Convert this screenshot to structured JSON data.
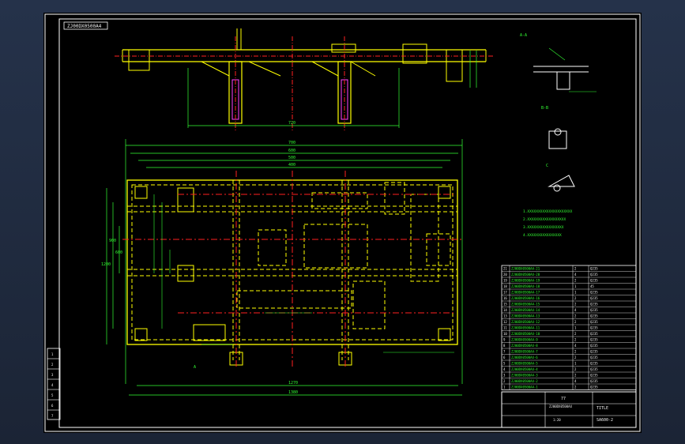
{
  "drawing": {
    "title_tag": "ZJ00DX0500A4",
    "frame_color": "#ffffff",
    "colors": {
      "yellow": "#ffff00",
      "red": "#ff2020",
      "green": "#33ff33",
      "cyan": "#00e5ff",
      "magenta": "#ff40ff",
      "white": "#ffffff"
    }
  },
  "detail_views": {
    "view_a": {
      "label": "A-A"
    },
    "view_b": {
      "label": "B-B"
    },
    "view_c": {
      "label": "C"
    }
  },
  "plan_view": {
    "section_marker": "A",
    "dims_top": [
      "700",
      "600",
      "500",
      "400"
    ],
    "dims_bottom": [
      "1270",
      "1380"
    ],
    "dims_left": [
      "1200",
      "900",
      "600"
    ]
  },
  "elevation_view": {
    "dim_label": "720"
  },
  "notes": {
    "lines": [
      "1.XXXXXXXXXXXXXXXXXXXXX",
      "2.XXXXXXXXXXXXXXXXXX",
      "3.XXXXXXXXXXXXXXXXX",
      "4.XXXXXXXXXXXXXXXX"
    ]
  },
  "bom": {
    "rows": [
      [
        "21",
        "ZJ00DX0500A4-21",
        "2",
        "Q235"
      ],
      [
        "20",
        "ZJ00DX0500A4-20",
        "4",
        "Q235"
      ],
      [
        "19",
        "ZJ00DX0500A4-19",
        "2",
        "Q235"
      ],
      [
        "18",
        "ZJ00DX0500A4-18",
        "1",
        "45"
      ],
      [
        "17",
        "ZJ00DX0500A4-17",
        "1",
        "Q235"
      ],
      [
        "16",
        "ZJ00DX0500A4-16",
        "2",
        "Q235"
      ],
      [
        "15",
        "ZJ00DX0500A4-15",
        "2",
        "Q235"
      ],
      [
        "14",
        "ZJ00DX0500A4-14",
        "4",
        "Q235"
      ],
      [
        "13",
        "ZJ00DX0500A4-13",
        "2",
        "Q235"
      ],
      [
        "12",
        "ZJ00DX0500A4-12",
        "2",
        "Q235"
      ],
      [
        "11",
        "ZJ00DX0500A4-11",
        "1",
        "Q235"
      ],
      [
        "10",
        "ZJ00DX0500A4-10",
        "2",
        "Q235"
      ],
      [
        "9",
        "ZJ00DX0500A4-9",
        "2",
        "Q235"
      ],
      [
        "8",
        "ZJ00DX0500A4-8",
        "4",
        "Q235"
      ],
      [
        "7",
        "ZJ00DX0500A4-7",
        "2",
        "Q235"
      ],
      [
        "6",
        "ZJ00DX0500A4-6",
        "2",
        "Q235"
      ],
      [
        "5",
        "ZJ00DX0500A4-5",
        "1",
        "Q235"
      ],
      [
        "4",
        "ZJ00DX0500A4-4",
        "2",
        "Q235"
      ],
      [
        "3",
        "ZJ00DX0500A4-3",
        "2",
        "Q235"
      ],
      [
        "2",
        "ZJ00DX0500A4-2",
        "4",
        "Q235"
      ],
      [
        "1",
        "ZJ00DX0500A4-1",
        "2",
        "Q235"
      ]
    ]
  },
  "title_block": {
    "drawing_no": "ZJ00DX0500A4",
    "scale": "1:20",
    "code": "77",
    "sheet_name": "TITLE",
    "part_name": "SA600-2"
  },
  "revision_block": {
    "cells": [
      "1",
      "2",
      "3",
      "4",
      "5",
      "6",
      "7"
    ]
  }
}
